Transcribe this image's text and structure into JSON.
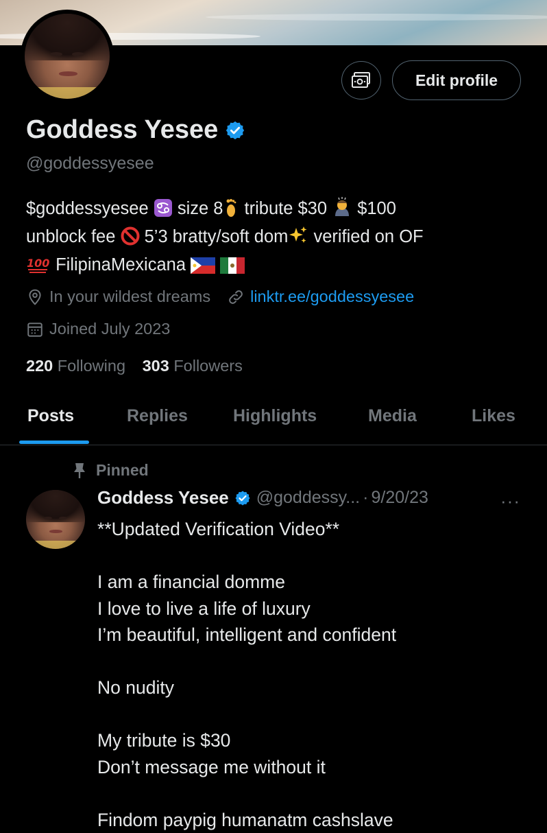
{
  "profile": {
    "name": "Goddess Yesee",
    "handle": "@goddessyesee",
    "bio": {
      "line1_a": "$goddessyesee ",
      "line1_b": " size 8",
      "line1_c": " tribute $30 ",
      "line1_d": " $100",
      "line2_a": "unblock fee ",
      "line2_b": " 5’3 bratty/soft dom",
      "line2_c": " verified on OF",
      "line3_a": " FilipinaMexicana "
    },
    "location": "In your wildest dreams",
    "website": "linktr.ee/goddessyesee",
    "joined": "Joined July 2023",
    "following_count": "220",
    "following_label": "Following",
    "followers_count": "303",
    "followers_label": "Followers"
  },
  "actions": {
    "edit_profile_label": "Edit profile"
  },
  "tabs": [
    {
      "label": "Posts",
      "active": true
    },
    {
      "label": "Replies",
      "active": false
    },
    {
      "label": "Highlights",
      "active": false
    },
    {
      "label": "Media",
      "active": false
    },
    {
      "label": "Likes",
      "active": false
    }
  ],
  "post": {
    "pinned_label": "Pinned",
    "author_name": "Goddess Yesee",
    "author_handle": "@goddessy...",
    "separator": "·",
    "date": "9/20/23",
    "more_label": "···",
    "lines": [
      "**Updated Verification Video**",
      "",
      "I am a financial domme",
      "I love to live a life of luxury",
      "I’m beautiful, intelligent and confident",
      "",
      "No nudity",
      "",
      "My tribute is $30",
      "Don’t message me without it",
      "",
      "Findom paypig humanatm cashslave"
    ]
  },
  "colors": {
    "background": "#000000",
    "text_primary": "#e7e9ea",
    "text_secondary": "#71767b",
    "accent": "#1d9bf0",
    "border": "#2f3336"
  }
}
